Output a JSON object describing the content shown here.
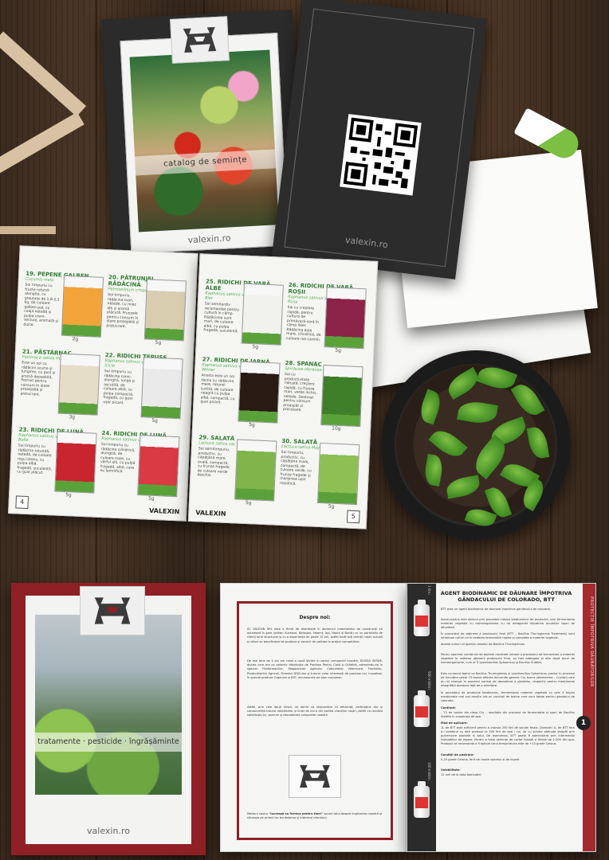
{
  "seed_catalog": {
    "caption": "catalog de semințe",
    "brand": "valexin.ro"
  },
  "qr_booklet": {
    "brand": "valexin.ro"
  },
  "seed_spread": {
    "left_page_number": "4",
    "right_page_number": "5",
    "footer_brand": "VALEXIN",
    "items": [
      {
        "title": "19. PEPENE GALBEN",
        "latin": "Cucumis melo",
        "desc": "Soi timpuriu cu fructe rotund-alungite, cu greutate de 1,8-2,2 kg, de culoare galben-pal, cu coaja netedă și pulpa crem-verzuie, aromată și dulce.",
        "weight": "2g",
        "color": "#f2a33a"
      },
      {
        "title": "20. PĂTRUNJEL RĂDĂCINĂ",
        "latin": "Petroselinum crispum Oberlaaer",
        "desc": "Soi timpuriu, rădăcina mari, netede, cu miez alb și aromă plăcută. Frunzele pentru consum în stare proaspătă și prelucrare.",
        "weight": "5g",
        "color": "#d9cdb0"
      },
      {
        "title": "21. PĂSTÂRNAC",
        "latin": "Pastinaca sativa Hollow crown",
        "desc": "Este un soi cu rădăcini scurte și lungime, cu gust și aromă deosebită. Potrivit pentru consum în stare proaspătă și prelucrare.",
        "weight": "3g",
        "color": "#e6ddc9"
      },
      {
        "title": "22. RIDICHI ȚEPUȘE",
        "latin": "Raphanus sativus var. longipinnatus Icicle",
        "desc": "Soi timpuriu cu rădăcina conic-alungită, lungă și ascuțită, de culoare albă, cu pulpa compactă, fragedă, cu gust ușor picant.",
        "weight": "5g",
        "color": "#eaeaea"
      },
      {
        "title": "23. RIDICHI DE LUNĂ",
        "latin": "Raphanus sativus var. sativus Cherry Belle",
        "desc": "Soi timpuriu cu rădăcina rotundă, netedă, de culoare roșu intens, cu pulpa albă, fragedă, suculentă, cu gust plăcut.",
        "weight": "5g",
        "color": "#c8252f"
      },
      {
        "title": "24. RIDICHI DE LUNĂ",
        "latin": "Raphanus sativus var. sativus Duero",
        "desc": "Soi timpuriu cu rădăcina cilindrică, alungită, de culoare roșie, cu vârful alb, cu pulpă fragedă, albă, care nu lemnifică.",
        "weight": "5g",
        "color": "#d93a44"
      },
      {
        "title": "25. RIDICHI DE VARĂ ALBE",
        "latin": "Raphanus sativus var. niger Munchen Bier",
        "desc": "Soi semitardiv recomandat pentru cultură în câmp. Rădăcinile sunt mari, de culoare albă, cu pulpa fragedă, suculentă.",
        "weight": "5g",
        "color": "#f1f1ee"
      },
      {
        "title": "26. RIDICHI DE VARĂ ROȘII",
        "latin": "Raphanus sativus var. niger Ostergruss Rosa",
        "desc": "Soi cu creștere rapidă, pentru cultura de primăvară-vară în câmp liber. Rădăcina este mare, cilindrică, de culoare roz-carmin.",
        "weight": "5g",
        "color": "#8c2348"
      },
      {
        "title": "27. RIDICHI DE IARNĂ",
        "latin": "Raphanus sativus var. niger Black Winter",
        "desc": "Acesta este un soi târziu cu rădăcina mare, rotund-turtită, de culoare neagră cu pulpa albă, compactă, cu gust picant.",
        "weight": "5g",
        "color": "#2a1a14"
      },
      {
        "title": "28. SPANAC",
        "latin": "Spinacea oleracea Matador",
        "desc": "Soi cu productivitate ridicată, creștere rapidă, cu frunze mari, verde închis, netede. Destinat pentru consum proaspăt și procesare.",
        "weight": "10g",
        "color": "#3f7f2a"
      },
      {
        "title": "29. SALATĂ",
        "latin": "Lactuca sativa var. capitata Amrokiton",
        "desc": "Soi semitimpuriu, productiv, cu căpățână mare, ovală, compactă, cu frunze fragede, de culoare verde deschis.",
        "weight": "5g",
        "color": "#7fb54a"
      },
      {
        "title": "30. SALATĂ",
        "latin": "Lactuca sativa May King",
        "desc": "Soi timpuriu, productiv, cu căpățâna mare, compactă, de culoare verde, cu frunze fragede și marginea ușor roșiatică.",
        "weight": "5g",
        "color": "#8dbf55"
      }
    ]
  },
  "pesticide_catalog": {
    "caption": "tratamente · pesticide · îngrășăminte",
    "brand": "valexin.ro"
  },
  "about_page": {
    "title": "Despre noi:",
    "paragraphs": [
      "SC VALEXIN SRL este o firmă de distribuție în domeniul materialelor de construcții ce activează în șase județe: Suceava, Botoșani, Neamț, Iași, Vaslui și Bacău cu un portofoliu de clienți bine structurat și cu o experiență de peste 15 ani, astfel încât toți clienții noștri actuali și viitori se beneficieze de produse și servicii de calitate la prețuri competitive.",
      "De mai bine de 4 ani am creat o nouă divizie în cadrul companiei noastre, DIVIZIA VERDE, divizie care are ca obiectiv distribuția de Produse Pentru Casă și Grădină, adresându-se în special: Fitofarmaciilor, Magazinelor Agricole, Cabinetelor Veterinare, Florăriilor, Producătorilor Agricoli, Firmelor DDD dar și tuturor celor interesați de produse noi, inovative, în special produse Organice și BIO, recunoscute pe plan european.",
      "Astfel, prin cele două divizii, ne dorim să răspundem cu eficiență, certitudine dar și consecvență tuturor solicitărilor și liniei de lucru din partea clienților noștri, astfel ca rezultat satisfacția lor, precum și dezvoltarea companiei noastre."
    ],
    "motto_intro": "Mottoul nostru",
    "motto": "\"lucrează ca furnica pentru tine!\"",
    "motto_rest": "spune totul despre implicarea noastră și situeaza pe primul loc bunăstarea și interesul clientului."
  },
  "product_page": {
    "title": "AGENT BIODINAMIC DE DĂUNARE ÎMPOTRIVA GÂNDACULUI DE COLORADO, BTT",
    "sidebar": "PROTECȚIE ÎMPOTRIVA DĂUNĂTORILOR",
    "page_number": "1",
    "volumes": [
      "1 litru",
      "500 mililitri",
      "100 mililitri"
    ],
    "paragraphs": [
      "BTT este un agent biodinamic de daunare impotriva gandacului de colorado.",
      "Acest produs este obtinut prin procedee clasice biodinamice de producție, prin fermentarea materiei vegetale cu microorganisme cu rol antagonist împotriva anumitor tipuri de dăunători.",
      "În procedeul de obținere a produsului final (BTT – Bacillus Thuringiensis Treatment) sunt introduse culturi vii în vederea fermentării rapide și complete a materiei vegetale.",
      "Aceste culturi vii aparțin claselor de Bacillus Thuringiensis.",
      "Pentru sporirea numărului de bacterii rezultate urmare a procesului de fermentare a materiei vegetale în vederea obținerii produsului final, au fost adăugate și alte două tipuri de microorganisme, cum ar fi Lysinibacillus Sphaericus și Bacillus Subtilis.",
      "Este cunoscut faptul ca Bacillus Thuringiensis și Lysinibacillus Sphaericus produc în procesul de înmulțire peste 73 toxine diferite denumite generic Cry toxins (abrevierea – Crystal) care au rol sinergic în procesul normal de dezvoltare a plantelor, respectiv pentru menținerea integrității acestora față de o solicitare.",
      "În procedeul de producție biodinamic, fermentarea materiei vegetale cu cele 3 tulpini menționate mai sus rezulta într-un cocktail de toxine care sunt fatale pentru gandacul de colorado."
    ],
    "sections": [
      {
        "head": "Continut:",
        "text": "- 73 de toxine din clasa Cry - rezultate din procesul de fermentatie și spori de Bacillus Subtilis in suspensie de apa."
      },
      {
        "head": "Mod de aplicare:",
        "text": "1L de BTT este suficient pentru a inocula 200 litri de solutie finala. Dizolvati 1L de BTT fara a-l combina cu alte produse la 200 litri de apa / ha, iar cu solutia obtinuta stropiti prin pulverizare plantele si solul. De asemenea, BTT poate fi administrat prin intermediul instalatiilor de irigare. Pentru a trata semințe de cartof folositi o diluție de 1:200 litri apa. Produsul se recomanda a fi aplicat cand temperatura este de +15 grade Celsius."
      },
      {
        "head": "Condiții de pastrare:",
        "text": "5-25 grade Celsius, ferit de razele soarelui si de inghet"
      },
      {
        "head": "Valabilitate:",
        "text": "12 luni de la data fabricatiei"
      }
    ]
  },
  "colors": {
    "wood": "#3f2e21",
    "brand_red": "#8f2026",
    "seed_green": "#2e7d32",
    "dark_booklet": "#2c2c2c"
  }
}
